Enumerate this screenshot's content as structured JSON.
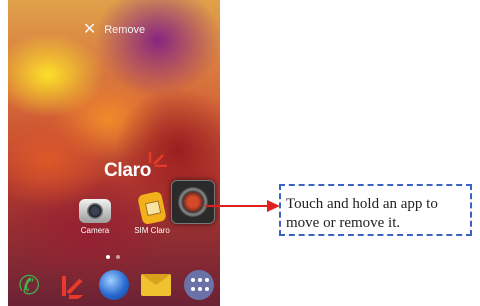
{
  "remove_bar": {
    "icon": "close-icon",
    "label": "Remove"
  },
  "brand": {
    "name": "Claro"
  },
  "apps": [
    {
      "label": "Camera",
      "icon": "camera-icon"
    },
    {
      "label": "SIM Claro",
      "icon": "sim-card-icon"
    }
  ],
  "dragged_app": {
    "icon": "dragged-app-icon"
  },
  "page_indicator": {
    "pages": 2,
    "current": 1
  },
  "dock": [
    {
      "icon": "phone-icon"
    },
    {
      "icon": "claro-icon"
    },
    {
      "icon": "globe-icon"
    },
    {
      "icon": "mail-icon"
    },
    {
      "icon": "app-drawer-icon"
    }
  ],
  "callout": {
    "text": "Touch and hold an app to move or remove it."
  },
  "colors": {
    "arrow": "#e02020",
    "callout_border": "#3b63c4"
  }
}
